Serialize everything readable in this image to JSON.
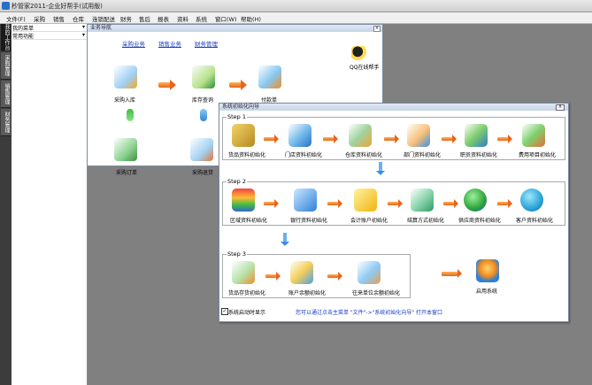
{
  "window": {
    "title": "秒管家2011-企业好帮手(试用版)"
  },
  "menu": [
    "文件(F)",
    "采购",
    "销售",
    "仓库",
    "连锁配送",
    "财务",
    "售后",
    "报表",
    "资料",
    "系统",
    "窗口(W)",
    "帮助(H)"
  ],
  "sidebar": {
    "tabs": [
      "我的工作台",
      "采购管理",
      "销售管理",
      "财务管理"
    ],
    "items": [
      {
        "label": "我的菜单"
      },
      {
        "label": "常用功能"
      }
    ]
  },
  "nav": {
    "title": "业务导航",
    "links": [
      "采购业务",
      "销售业务",
      "财务管理"
    ],
    "qq_label": "QQ在线帮手",
    "nodes": [
      "采购入库",
      "库存查询",
      "付款单",
      "采购订单",
      "采购退货"
    ]
  },
  "wizard": {
    "title": "系统初始化向导",
    "close": "X",
    "step1": {
      "label": "Step 1",
      "items": [
        "货品资料初始化",
        "门店资料初始化",
        "仓库资料初始化",
        "部门资料初始化",
        "职员资料初始化",
        "费用项目初始化"
      ]
    },
    "step2": {
      "label": "Step 2",
      "items": [
        "区域资料初始化",
        "银行资料初始化",
        "会计账户初始化",
        "结算方式初始化",
        "供应商资料初始化",
        "客户资料初始化"
      ]
    },
    "step3": {
      "label": "Step 3",
      "items": [
        "货品存货初始化",
        "账户余额初始化",
        "往来单位余额初始化"
      ]
    },
    "enable": "启用系统",
    "checkbox_label": "系统启动时显示",
    "checkbox_checked": true,
    "hint": "您可以通过点击主菜单 \"文件\"->\"系统初始化向导\" 打开本窗口"
  }
}
